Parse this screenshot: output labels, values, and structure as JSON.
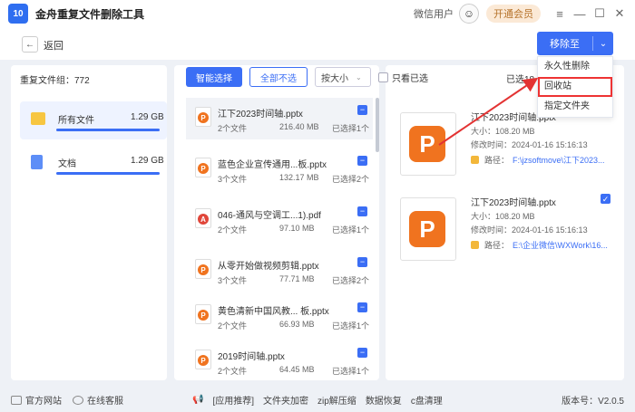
{
  "titlebar": {
    "logo_text": "10",
    "app_title": "金舟重复文件删除工具",
    "username": "微信用户",
    "vip_label": "开通会员",
    "menu_icon": "≡",
    "minimize_icon": "—",
    "maximize_icon": "☐",
    "close_icon": "✕"
  },
  "toolbar": {
    "back_label": "返回",
    "move_button": "移除至",
    "dropdown": [
      "永久性删除",
      "回收站",
      "指定文件夹"
    ]
  },
  "sidebar": {
    "title": "重复文件组：772",
    "items": [
      {
        "label": "所有文件",
        "size": "1.29 GB"
      },
      {
        "label": "文档",
        "size": "1.29 GB"
      }
    ]
  },
  "filters": {
    "smart_select": "智能选择",
    "unselect_all": "全部不选",
    "sort_label": "按大小",
    "show_selected": "只看已选",
    "selected_info": "已选18"
  },
  "file_list": [
    {
      "name": "江下2023时间轴.pptx",
      "count": "2个文件",
      "size": "216.40 MB",
      "selected": "已选择1个",
      "type": "P"
    },
    {
      "name": "蓝色企业宣传通用...板.pptx",
      "count": "3个文件",
      "size": "132.17 MB",
      "selected": "已选择2个",
      "type": "P"
    },
    {
      "name": "046-通风与空调工...1).pdf",
      "count": "2个文件",
      "size": "97.10 MB",
      "selected": "已选择1个",
      "type": "A"
    },
    {
      "name": "从零开始做视频剪辑.pptx",
      "count": "3个文件",
      "size": "77.71 MB",
      "selected": "已选择2个",
      "type": "P"
    },
    {
      "name": "黄色清新中国风教... 板.pptx",
      "count": "2个文件",
      "size": "66.93 MB",
      "selected": "已选择1个",
      "type": "P"
    },
    {
      "name": "2019时间轴.pptx",
      "count": "2个文件",
      "size": "64.45 MB",
      "selected": "已选择1个",
      "type": "P"
    }
  ],
  "details": [
    {
      "name": "江下2023时间轴.pptx",
      "size": "大小：108.20 MB",
      "time": "修改时间：2024-01-16 15:16:13",
      "path_label": "路径：",
      "path": "F:\\jzsoftmove\\江下2023...",
      "checked": false
    },
    {
      "name": "江下2023时间轴.pptx",
      "size": "大小：108.20 MB",
      "time": "修改时间：2024-01-16 15:16:13",
      "path_label": "路径：",
      "path": "E:\\企业微信\\WXWork\\16...",
      "checked": true
    }
  ],
  "footer": {
    "website": "官方网站",
    "support": "在线客服",
    "links": [
      "[应用推荐]",
      "文件夹加密",
      "zip解压缩",
      "数据恢复",
      "c盘清理"
    ],
    "version": "版本号：V2.0.5"
  },
  "colors": {
    "accent": "#3b6ef5",
    "ppt_orange": "#f0731f",
    "pdf_red": "#e0463a",
    "highlight_red": "#e33333"
  }
}
